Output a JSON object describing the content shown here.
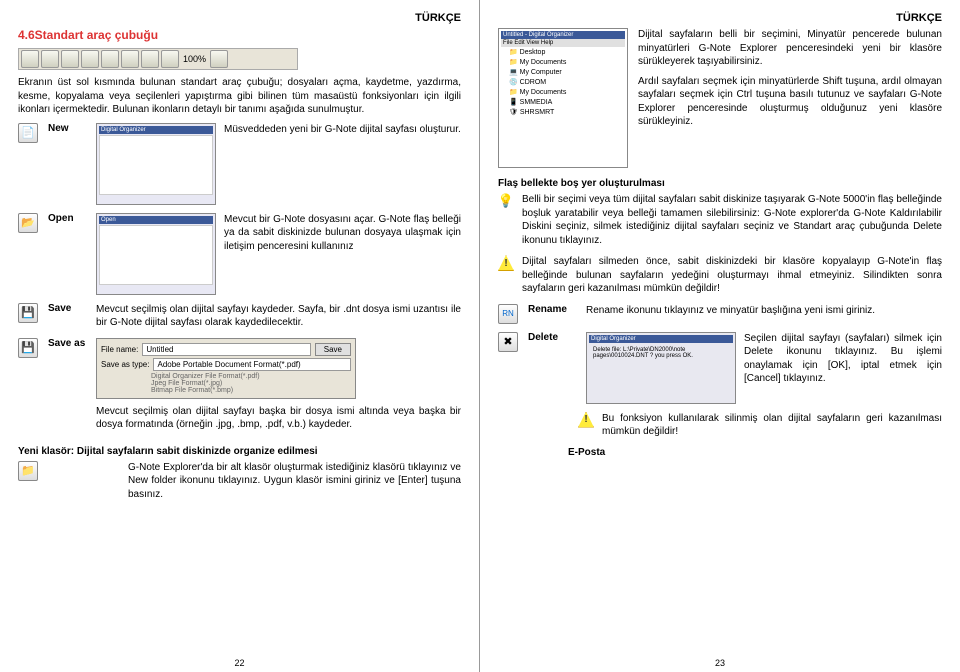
{
  "lang": {
    "turkce": "TÜRKÇE"
  },
  "left": {
    "sectionTitle": "4.6Standart araç çubuğu",
    "toolbarPercent": "100%",
    "intro": "Ekranın üst sol kısmında bulunan standart araç çubuğu; dosyaları açma, kaydetme, yazdırma, kesme, kopyalama veya seçilenleri yapıştırma gibi bilinen tüm masaüstü fonksiyonları için ilgili ikonları içermektedir. Bulunan ikonların detaylı bir tanımı aşağıda sunulmuştur.",
    "new": {
      "label": "New",
      "desc": "Müsveddeden yeni bir G-Note dijital sayfası oluşturur."
    },
    "open": {
      "label": "Open",
      "desc": "Mevcut bir G-Note dosyasını açar. G-Note flaş belleği ya da sabit diskinizde bulunan dosyaya ulaşmak için iletişim penceresini kullanınız"
    },
    "save": {
      "label": "Save",
      "desc": "Mevcut seçilmiş olan dijital sayfayı kaydeder. Sayfa, bir .dnt dosya ismi uzantısı ile bir G-Note dijital sayfası olarak kaydedilecektir."
    },
    "saveas": {
      "label": "Save as",
      "filenameLabel": "File name:",
      "filenameValue": "Untitled",
      "saveBtn": "Save",
      "typeLabel": "Save as type:",
      "typeValue": "Adobe Portable Document Format(*.pdf)",
      "types": "Digital Organizer File Format(*.pdf)\nJpeg File Format(*.jpg)\nBitmap File Format(*.bmp)",
      "desc": "Mevcut seçilmiş olan dijital sayfayı başka bir dosya ismi altında veya başka bir dosya formatında (örneğin .jpg, .bmp, .pdf, v.b.) kaydeder."
    },
    "newFolder": {
      "heading": "Yeni klasör: Dijital sayfaların sabit diskinizde organize edilmesi",
      "desc": "G-Note Explorer'da bir alt klasör oluşturmak istediğiniz klasörü tıklayınız ve New folder ikonunu tıklayınız. Uygun klasör ismini giriniz ve [Enter] tuşuna basınız."
    },
    "pageNum": "22"
  },
  "right": {
    "tree": {
      "title": "Untitled - Digital Organizer",
      "menu": "File  Edit  View  Help",
      "items": [
        "📁 Desktop",
        "  📁 My Documents",
        "  💻 My Computer",
        "    💿 CDROM",
        "    📁 My Documents",
        "    📱 SMMEDIA",
        "    🛡 SHRSMRT"
      ]
    },
    "para1": "Dijital sayfaların belli bir seçimini, Minyatür pencerede bulunan minyatürleri G-Note Explorer penceresindeki yeni bir klasöre sürükleyerek taşıyabilirsiniz.",
    "para2": "Ardıl sayfaları seçmek için minyatürlerde Shift tuşuna, ardıl olmayan sayfaları seçmek için Ctrl tuşuna basılı tutunuz ve sayfaları G-Note Explorer penceresinde oluşturmuş olduğunuz yeni klasöre sürükleyiniz.",
    "flashHeading": "Flaş bellekte boş yer oluşturulması",
    "tip1": "Belli bir seçimi veya tüm dijital sayfaları sabit diskinize taşıyarak G-Note 5000'in flaş belleğinde boşluk yaratabilir veya belleği tamamen silebilirsiniz: G-Note explorer'da G-Note Kaldırılabilir Diskini seçiniz, silmek istediğiniz dijital sayfaları seçiniz ve Standart araç çubuğunda Delete ikonunu tıklayınız.",
    "warn1": "Dijital sayfaları silmeden önce, sabit diskinizdeki bir klasöre kopyalayıp G-Note'in flaş belleğinde bulunan sayfaların yedeğini oluşturmayı ihmal etmeyiniz. Silindikten sonra sayfaların geri kazanılması mümkün değildir!",
    "rename": {
      "label": "Rename",
      "desc": "Rename ikonunu tıklayınız ve minyatür başlığına yeni ismi giriniz."
    },
    "delete": {
      "label": "Delete",
      "dialogTitle": "Digital Organizer",
      "dialogText": "Delete file: L:\\Private\\DN2000\\note pages\\0010024.DNT ? you press OK.",
      "desc": "Seçilen dijital sayfayı (sayfaları) silmek için Delete ikonunu tıklayınız. Bu işlemi onaylamak için [OK], iptal etmek için [Cancel] tıklayınız."
    },
    "warn2": "Bu fonksiyon kullanılarak silinmiş olan dijital sayfaların geri kazanılması mümkün değildir!",
    "eposta": "E-Posta",
    "pageNum": "23"
  }
}
